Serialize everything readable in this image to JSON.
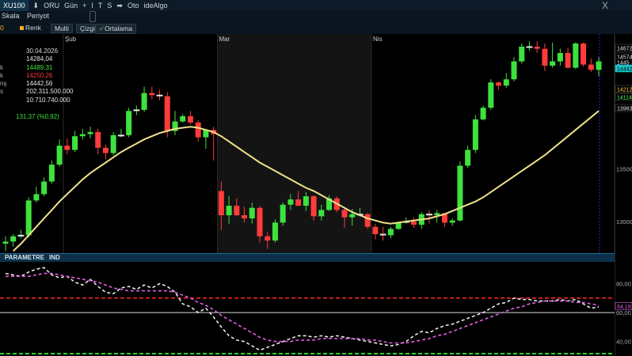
{
  "toolbar": {
    "symbol": "XU100",
    "items": [
      "ORU",
      "Gün",
      "+",
      "I",
      "T",
      "S",
      "Oto",
      "ideAlgo"
    ],
    "close": "X"
  },
  "toolbar2": {
    "skala": "Skala",
    "periyot": "Periyot"
  },
  "toolbar3": {
    "zero": "0",
    "renk": "Renk",
    "multi": "Multi",
    "cizgi": "Çizgi",
    "ortalama": "Ortalama"
  },
  "info": {
    "date": "30.04.2026",
    "rows": [
      {
        "label": "",
        "value": "14284,04",
        "color": "#e0e6ea"
      },
      {
        "label": "k",
        "value": "14489,31",
        "color": "#3ee23e"
      },
      {
        "label": "k",
        "value": "14250,26",
        "color": "#ff3b3b"
      },
      {
        "label": "nş",
        "value": "14442,56",
        "color": "#e0e6ea"
      },
      {
        "label": "s",
        "value": "202.311.500.000",
        "color": "#e0e6ea"
      },
      {
        "label": "",
        "value": "10.710.740.000",
        "color": "#e0e6ea"
      }
    ],
    "change": "131,37 (%0,92)"
  },
  "param_header": {
    "left": "PARAMETRE",
    "right": "IND"
  },
  "chart_data": [
    {
      "type": "candlestick",
      "title": "",
      "x_months": [
        {
          "label": "Şub",
          "index": 8
        },
        {
          "label": "Mar",
          "index": 28
        },
        {
          "label": "Nis",
          "index": 48
        }
      ],
      "y_ticks": [
        13000,
        13500
      ],
      "ylim": [
        12700,
        14780
      ],
      "price_labels": [
        {
          "value": "14672",
          "color": "#dfe6ee",
          "bg": "#000"
        },
        {
          "value": "14574",
          "color": "#dfe6ee",
          "bg": "#000"
        },
        {
          "value": "1445",
          "color": "#dfe6ee",
          "bg": "#000"
        },
        {
          "value": "14442",
          "color": "#000",
          "bg": "#17c3c9"
        },
        {
          "value": "14212",
          "color": "#ffc83a",
          "bg": "#000"
        },
        {
          "value": "14114",
          "color": "#55ff55",
          "bg": "#000"
        },
        {
          "value": "13983",
          "color": "#dfe6ee",
          "bg": "#000"
        }
      ],
      "candles": [
        [
          12790,
          12860,
          12720,
          12810
        ],
        [
          12810,
          12880,
          12760,
          12860
        ],
        [
          12860,
          12920,
          12840,
          12870
        ],
        [
          12870,
          13230,
          12850,
          13200
        ],
        [
          13200,
          13330,
          13180,
          13260
        ],
        [
          13260,
          13420,
          13240,
          13380
        ],
        [
          13380,
          13580,
          13360,
          13540
        ],
        [
          13540,
          13780,
          13520,
          13720
        ],
        [
          13720,
          13790,
          13640,
          13680
        ],
        [
          13680,
          13860,
          13660,
          13810
        ],
        [
          13810,
          13880,
          13780,
          13830
        ],
        [
          13830,
          13900,
          13790,
          13850
        ],
        [
          13850,
          13880,
          13640,
          13700
        ],
        [
          13700,
          13730,
          13590,
          13650
        ],
        [
          13650,
          13850,
          13630,
          13820
        ],
        [
          13820,
          13880,
          13800,
          13820
        ],
        [
          13820,
          14080,
          13800,
          14050
        ],
        [
          14050,
          14100,
          14010,
          14060
        ],
        [
          14060,
          14280,
          14040,
          14220
        ],
        [
          14220,
          14280,
          14160,
          14200
        ],
        [
          14200,
          14250,
          14150,
          14190
        ],
        [
          14190,
          14230,
          13800,
          13860
        ],
        [
          13860,
          14050,
          13820,
          13950
        ],
        [
          13950,
          14020,
          13940,
          14000
        ],
        [
          14000,
          14050,
          13920,
          13940
        ],
        [
          13940,
          13960,
          13760,
          13800
        ],
        [
          13800,
          13880,
          13690,
          13870
        ],
        [
          13870,
          13900,
          13580,
          13830
        ],
        [
          13290,
          13380,
          12920,
          13060
        ],
        [
          13060,
          13240,
          12980,
          13150
        ],
        [
          13150,
          13220,
          13050,
          13060
        ],
        [
          13060,
          13140,
          12990,
          13030
        ],
        [
          13030,
          13180,
          12980,
          13130
        ],
        [
          13130,
          13150,
          12800,
          12860
        ],
        [
          12860,
          12900,
          12740,
          12820
        ],
        [
          12820,
          13020,
          12800,
          12990
        ],
        [
          12990,
          13180,
          12960,
          13160
        ],
        [
          13160,
          13260,
          13110,
          13210
        ],
        [
          13210,
          13290,
          13160,
          13150
        ],
        [
          13150,
          13280,
          13100,
          13240
        ],
        [
          13240,
          13250,
          13010,
          13050
        ],
        [
          13050,
          13160,
          13010,
          13110
        ],
        [
          13110,
          13250,
          13100,
          13220
        ],
        [
          13220,
          13240,
          13090,
          13110
        ],
        [
          13110,
          13140,
          12940,
          13040
        ],
        [
          13040,
          13120,
          12960,
          13070
        ],
        [
          13070,
          13130,
          13050,
          13070
        ],
        [
          13070,
          13080,
          12930,
          12950
        ],
        [
          12950,
          12980,
          12830,
          12880
        ],
        [
          12880,
          12950,
          12820,
          12870
        ],
        [
          12870,
          12950,
          12840,
          12930
        ],
        [
          12930,
          13000,
          12920,
          12990
        ],
        [
          12990,
          13040,
          12980,
          13000
        ],
        [
          13000,
          13040,
          12940,
          12970
        ],
        [
          12970,
          13090,
          12930,
          13070
        ],
        [
          13070,
          13110,
          12980,
          13060
        ],
        [
          13060,
          13110,
          12990,
          13080
        ],
        [
          13080,
          13080,
          12950,
          12990
        ],
        [
          12990,
          13030,
          12960,
          13010
        ],
        [
          13010,
          13570,
          13000,
          13530
        ],
        [
          13530,
          13720,
          13510,
          13680
        ],
        [
          13680,
          14010,
          13650,
          13970
        ],
        [
          13970,
          14100,
          13960,
          14080
        ],
        [
          14080,
          14350,
          14060,
          14320
        ],
        [
          14320,
          14330,
          14250,
          14290
        ],
        [
          14290,
          14410,
          14270,
          14350
        ],
        [
          14350,
          14560,
          14330,
          14520
        ],
        [
          14520,
          14690,
          14500,
          14660
        ],
        [
          14660,
          14710,
          14620,
          14660
        ],
        [
          14660,
          14710,
          14600,
          14640
        ],
        [
          14640,
          14690,
          14430,
          14480
        ],
        [
          14480,
          14700,
          14460,
          14520
        ],
        [
          14520,
          14640,
          14480,
          14600
        ],
        [
          14600,
          14650,
          14450,
          14460
        ],
        [
          14460,
          14700,
          14450,
          14690
        ],
        [
          14690,
          14700,
          14470,
          14490
        ],
        [
          14490,
          14550,
          14420,
          14440
        ],
        [
          14440,
          14560,
          14380,
          14520
        ]
      ],
      "moving_average": [
        12650,
        12720,
        12790,
        12870,
        12950,
        13030,
        13110,
        13190,
        13260,
        13330,
        13400,
        13460,
        13510,
        13560,
        13610,
        13660,
        13700,
        13740,
        13780,
        13810,
        13840,
        13860,
        13880,
        13890,
        13900,
        13890,
        13870,
        13850,
        13810,
        13760,
        13710,
        13660,
        13610,
        13560,
        13520,
        13480,
        13440,
        13400,
        13360,
        13320,
        13290,
        13250,
        13210,
        13170,
        13130,
        13090,
        13060,
        13030,
        13010,
        12990,
        12980,
        12990,
        13000,
        13010,
        13020,
        13030,
        13050,
        13070,
        13100,
        13130,
        13160,
        13190,
        13230,
        13280,
        13330,
        13380,
        13430,
        13480,
        13530,
        13580,
        13630,
        13690,
        13750,
        13810,
        13870,
        13930,
        13990,
        14050
      ]
    },
    {
      "type": "line",
      "title": "",
      "y_ticks": [
        40,
        60,
        80
      ],
      "ylim": [
        30,
        95
      ],
      "upper_level": 70,
      "lower_level": 60,
      "value_label": "64,19",
      "series": [
        {
          "name": "",
          "color": "#e8e8e8",
          "values": [
            87,
            86,
            85,
            88,
            90,
            91,
            86,
            84,
            85,
            81,
            79,
            83,
            78,
            74,
            73,
            77,
            78,
            76,
            79,
            77,
            80,
            78,
            74,
            66,
            64,
            60,
            63,
            57,
            50,
            44,
            41,
            40,
            37,
            34,
            36,
            38,
            40,
            42,
            44,
            44,
            43,
            44,
            43,
            44,
            43,
            42,
            41,
            40,
            39,
            38,
            37,
            38,
            40,
            44,
            47,
            46,
            49,
            51,
            52,
            54,
            56,
            58,
            60,
            63,
            66,
            67,
            70,
            69,
            69,
            68,
            68,
            68,
            69,
            68,
            69,
            66,
            63,
            64
          ]
        },
        {
          "name": "",
          "color": "#e060e0",
          "values": [
            85,
            85,
            85,
            85,
            86,
            87,
            87,
            86,
            85,
            84,
            83,
            82,
            81,
            79,
            77,
            76,
            75,
            75,
            75,
            75,
            75,
            75,
            74,
            72,
            70,
            67,
            65,
            62,
            58,
            55,
            52,
            49,
            46,
            43,
            41,
            40,
            40,
            40,
            41,
            41,
            41,
            42,
            42,
            42,
            42,
            42,
            42,
            41,
            41,
            40,
            39,
            39,
            39,
            40,
            41,
            42,
            44,
            45,
            47,
            49,
            51,
            53,
            55,
            57,
            59,
            61,
            63,
            64,
            66,
            67,
            68,
            68,
            68,
            68,
            67,
            67,
            66,
            65
          ]
        }
      ]
    }
  ]
}
